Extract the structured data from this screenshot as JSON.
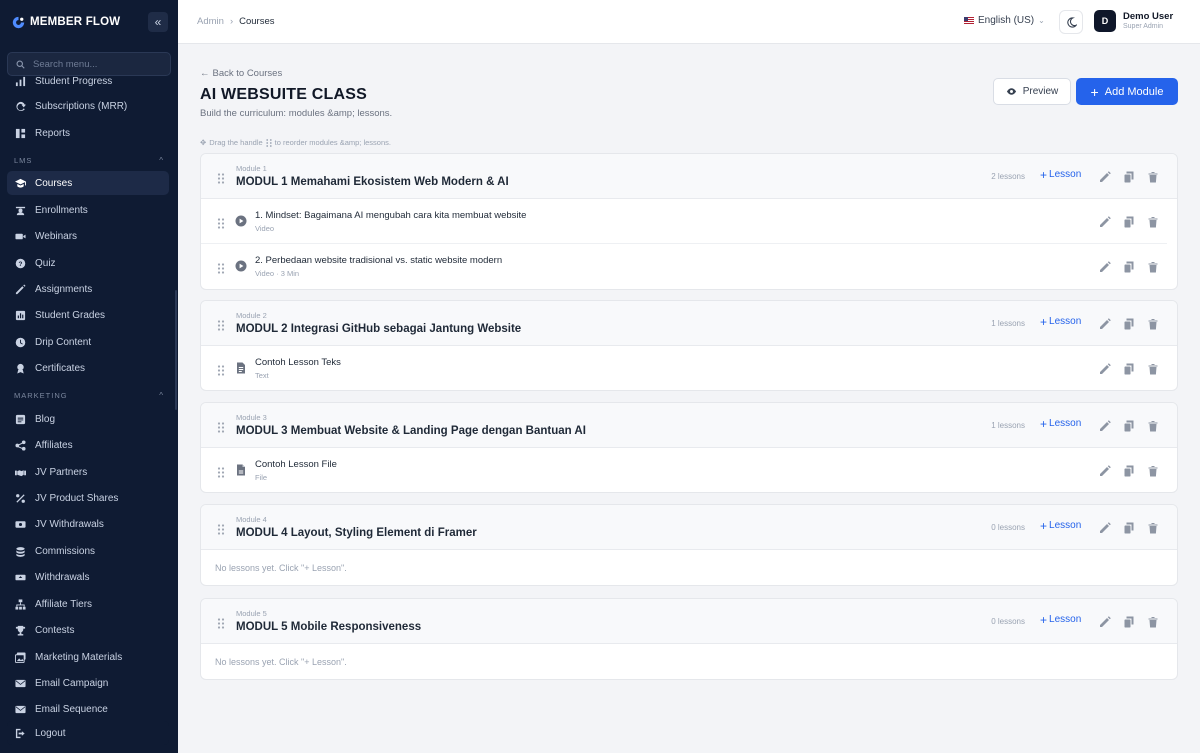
{
  "sidebar": {
    "brand": "MEMBER FLOW",
    "search_placeholder": "Search menu...",
    "items": [
      {
        "label": "Student Progress",
        "icon": "progress-icon"
      },
      {
        "label": "Subscriptions (MRR)",
        "icon": "refresh-icon"
      },
      {
        "label": "Reports",
        "icon": "reports-icon"
      },
      {
        "label": "Courses",
        "icon": "graduation-cap-icon",
        "active": true
      },
      {
        "label": "Enrollments",
        "icon": "student-icon"
      },
      {
        "label": "Webinars",
        "icon": "video-icon"
      },
      {
        "label": "Quiz",
        "icon": "question-icon"
      },
      {
        "label": "Assignments",
        "icon": "pencil-icon"
      },
      {
        "label": "Student Grades",
        "icon": "chart-icon"
      },
      {
        "label": "Drip Content",
        "icon": "clock-icon"
      },
      {
        "label": "Certificates",
        "icon": "certificate-icon"
      },
      {
        "label": "Blog",
        "icon": "blog-icon"
      },
      {
        "label": "Affiliates",
        "icon": "share-icon"
      },
      {
        "label": "JV Partners",
        "icon": "handshake-icon"
      },
      {
        "label": "JV Product Shares",
        "icon": "percent-icon"
      },
      {
        "label": "JV Withdrawals",
        "icon": "money-icon"
      },
      {
        "label": "Commissions",
        "icon": "coins-icon"
      },
      {
        "label": "Withdrawals",
        "icon": "withdraw-icon"
      },
      {
        "label": "Affiliate Tiers",
        "icon": "tiers-icon"
      },
      {
        "label": "Contests",
        "icon": "trophy-icon"
      },
      {
        "label": "Marketing Materials",
        "icon": "images-icon"
      },
      {
        "label": "Email Campaign",
        "icon": "mail-icon"
      },
      {
        "label": "Email Sequence",
        "icon": "mail-sequence-icon"
      }
    ],
    "sections": {
      "lms": "LMS",
      "marketing": "MARKETING"
    },
    "logout": "Logout"
  },
  "topbar": {
    "breadcrumb_root": "Admin",
    "breadcrumb_current": "Courses",
    "language": "English (US)",
    "user_initial": "D",
    "user_name": "Demo User",
    "user_role": "Super Admin"
  },
  "page": {
    "back_label": "Back to Courses",
    "title": "AI WEBSUITE CLASS",
    "subtitle": "Build the curriculum: modules &amp; lessons.",
    "hint_before": "Drag the handle",
    "hint_after": "to reorder modules &amp; lessons.",
    "preview_label": "Preview",
    "add_module_label": "Add Module",
    "add_lesson_label": "Lesson",
    "empty_text": "No lessons yet. Click \"+ Lesson\"."
  },
  "modules": [
    {
      "number": "Module 1",
      "title": "MODUL 1 Memahami Ekosistem Web Modern & AI",
      "count": "2 lessons",
      "lessons": [
        {
          "title": "1. Mindset: Bagaimana AI mengubah cara kita membuat website",
          "meta": "Video",
          "type": "video"
        },
        {
          "title": "2. Perbedaan website tradisional vs. static website modern",
          "meta": "Video · 3 Min",
          "type": "video"
        }
      ]
    },
    {
      "number": "Module 2",
      "title": "MODUL 2 Integrasi GitHub sebagai Jantung Website",
      "count": "1 lessons",
      "lessons": [
        {
          "title": "Contoh Lesson Teks",
          "meta": "Text",
          "type": "text"
        }
      ]
    },
    {
      "number": "Module 3",
      "title": "MODUL 3 Membuat Website & Landing Page dengan Bantuan AI",
      "count": "1 lessons",
      "lessons": [
        {
          "title": "Contoh Lesson File",
          "meta": "File",
          "type": "file"
        }
      ]
    },
    {
      "number": "Module 4",
      "title": "MODUL 4 Layout, Styling Element di Framer",
      "count": "0 lessons",
      "lessons": []
    },
    {
      "number": "Module 5",
      "title": "MODUL 5 Mobile Responsiveness",
      "count": "0 lessons",
      "lessons": []
    }
  ],
  "colors": {
    "sidebar_bg": "#0f1b33",
    "accent": "#2563eb",
    "page_bg": "#f3f4f7"
  }
}
